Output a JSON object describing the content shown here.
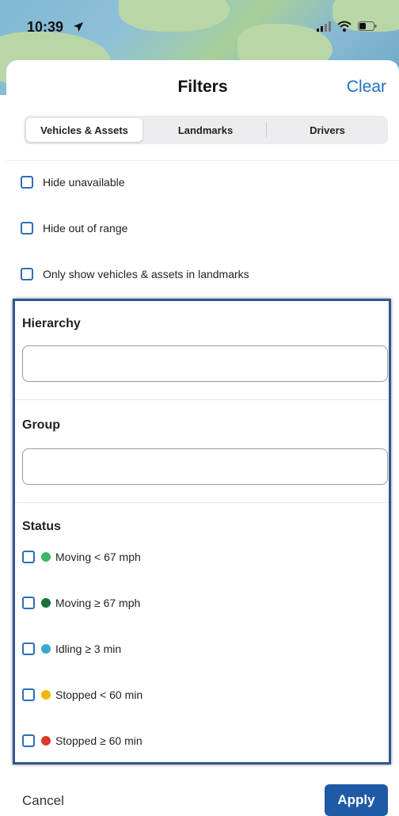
{
  "status_bar": {
    "time": "10:39",
    "icons": [
      "location-arrow-icon",
      "cellular-signal-icon",
      "wifi-icon",
      "battery-icon"
    ]
  },
  "header": {
    "title": "Filters",
    "clear_label": "Clear"
  },
  "tabs": [
    {
      "label": "Vehicles & Assets",
      "active": true
    },
    {
      "label": "Landmarks",
      "active": false
    },
    {
      "label": "Drivers",
      "active": false
    }
  ],
  "options": [
    {
      "label": "Hide unavailable",
      "checked": false
    },
    {
      "label": "Hide out of range",
      "checked": false
    },
    {
      "label": "Only show vehicles & assets in landmarks",
      "checked": false
    }
  ],
  "hierarchy": {
    "label": "Hierarchy",
    "value": ""
  },
  "group": {
    "label": "Group",
    "value": ""
  },
  "status": {
    "label": "Status",
    "items": [
      {
        "label": "Moving < 67 mph",
        "color": "#3fb56a",
        "checked": false
      },
      {
        "label": "Moving ≥ 67 mph",
        "color": "#17703a",
        "checked": false
      },
      {
        "label": "Idling ≥ 3 min",
        "color": "#36a9d3",
        "checked": false
      },
      {
        "label": "Stopped < 60 min",
        "color": "#f2b705",
        "checked": false
      },
      {
        "label": "Stopped ≥ 60 min",
        "color": "#e0362c",
        "checked": false
      }
    ]
  },
  "footer": {
    "cancel_label": "Cancel",
    "apply_label": "Apply"
  },
  "colors": {
    "accent": "#1e6fc2",
    "apply_button": "#1f5aa6",
    "checkbox_border": "#2f6db5",
    "highlight_frame": "#2f568f"
  }
}
